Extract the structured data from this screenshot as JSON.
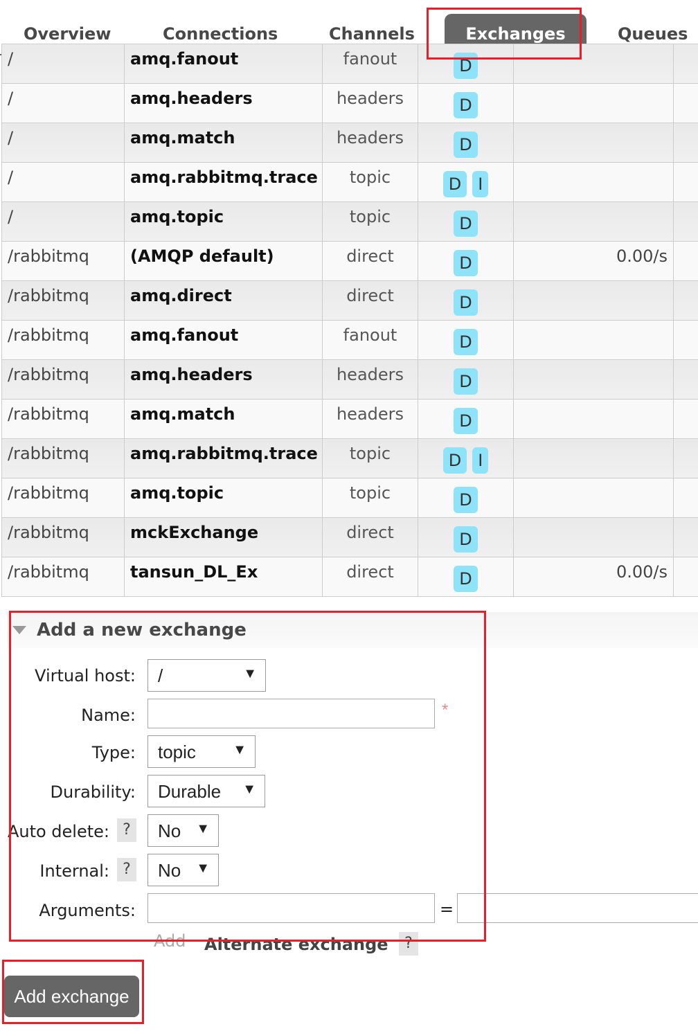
{
  "nav": {
    "tabs": [
      {
        "label": "Overview",
        "active": false
      },
      {
        "label": "Connections",
        "active": false
      },
      {
        "label": "Channels",
        "active": false
      },
      {
        "label": "Exchanges",
        "active": true
      },
      {
        "label": "Queues",
        "active": false
      }
    ]
  },
  "exchanges": {
    "rows": [
      {
        "vhost": "/",
        "name": "amq.fanout",
        "type": "fanout",
        "features": [
          "D"
        ],
        "rate": ""
      },
      {
        "vhost": "/",
        "name": "amq.headers",
        "type": "headers",
        "features": [
          "D"
        ],
        "rate": ""
      },
      {
        "vhost": "/",
        "name": "amq.match",
        "type": "headers",
        "features": [
          "D"
        ],
        "rate": ""
      },
      {
        "vhost": "/",
        "name": "amq.rabbitmq.trace",
        "type": "topic",
        "features": [
          "D",
          "I"
        ],
        "rate": ""
      },
      {
        "vhost": "/",
        "name": "amq.topic",
        "type": "topic",
        "features": [
          "D"
        ],
        "rate": ""
      },
      {
        "vhost": "/rabbitmq",
        "name": "(AMQP default)",
        "type": "direct",
        "features": [
          "D"
        ],
        "rate": "0.00/s"
      },
      {
        "vhost": "/rabbitmq",
        "name": "amq.direct",
        "type": "direct",
        "features": [
          "D"
        ],
        "rate": ""
      },
      {
        "vhost": "/rabbitmq",
        "name": "amq.fanout",
        "type": "fanout",
        "features": [
          "D"
        ],
        "rate": ""
      },
      {
        "vhost": "/rabbitmq",
        "name": "amq.headers",
        "type": "headers",
        "features": [
          "D"
        ],
        "rate": ""
      },
      {
        "vhost": "/rabbitmq",
        "name": "amq.match",
        "type": "headers",
        "features": [
          "D"
        ],
        "rate": ""
      },
      {
        "vhost": "/rabbitmq",
        "name": "amq.rabbitmq.trace",
        "type": "topic",
        "features": [
          "D",
          "I"
        ],
        "rate": ""
      },
      {
        "vhost": "/rabbitmq",
        "name": "amq.topic",
        "type": "topic",
        "features": [
          "D"
        ],
        "rate": ""
      },
      {
        "vhost": "/rabbitmq",
        "name": "mckExchange",
        "type": "direct",
        "features": [
          "D"
        ],
        "rate": ""
      },
      {
        "vhost": "/rabbitmq",
        "name": "tansun_DL_Ex",
        "type": "direct",
        "features": [
          "D"
        ],
        "rate": "0.00/s"
      }
    ]
  },
  "form": {
    "title": "Add a new exchange",
    "virtual_host_label": "Virtual host:",
    "virtual_host_value": "/",
    "name_label": "Name:",
    "name_value": "",
    "required_mark": "*",
    "type_label": "Type:",
    "type_value": "topic",
    "durability_label": "Durability:",
    "durability_value": "Durable",
    "auto_delete_label": "Auto delete:",
    "auto_delete_value": "No",
    "internal_label": "Internal:",
    "internal_value": "No",
    "arguments_label": "Arguments:",
    "arguments_equals": "=",
    "add_link": "Add",
    "alternate_exchange_label": "Alternate exchange",
    "help_mark": "?",
    "dropdown_arrow": "▼",
    "submit_label": "Add exchange"
  },
  "colors": {
    "tab_active_bg": "#666666",
    "badge_bg": "#8ee3f8",
    "highlight_border": "#e5202a"
  }
}
